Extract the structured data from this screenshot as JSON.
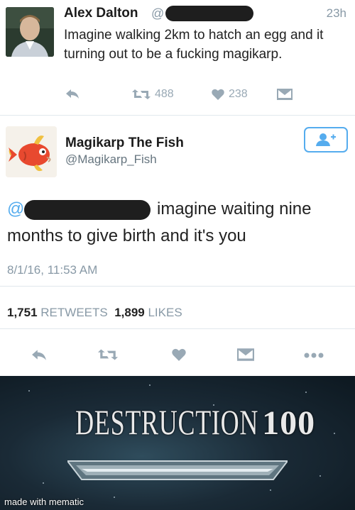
{
  "tweet1": {
    "author_name": "Alex Dalton",
    "handle_prefix": "@",
    "time": "23h",
    "text": "Imagine walking 2km to hatch an egg and it turning out to be a fucking magikarp.",
    "retweets": "488",
    "likes": "238"
  },
  "tweet2": {
    "author_name": "Magikarp The Fish",
    "handle": "@Magikarp_Fish",
    "mention_prefix": "@",
    "text_line1": "imagine waiting nine",
    "text_line2": "months to give birth and it's you",
    "date": "8/1/16, 11:53 AM",
    "retweet_count": "1,751",
    "retweet_label": "RETWEETS",
    "like_count": "1,899",
    "like_label": "LIKES"
  },
  "meme": {
    "skill_word": "DESTRUCTION",
    "skill_level": "100",
    "watermark": "made with mematic"
  },
  "colors": {
    "accent": "#55acee",
    "muted": "#8899a6",
    "action_icons": "#99a9b5"
  },
  "icons": [
    "reply-icon",
    "retweet-icon",
    "like-icon",
    "message-icon",
    "more-icon",
    "follow-icon"
  ]
}
